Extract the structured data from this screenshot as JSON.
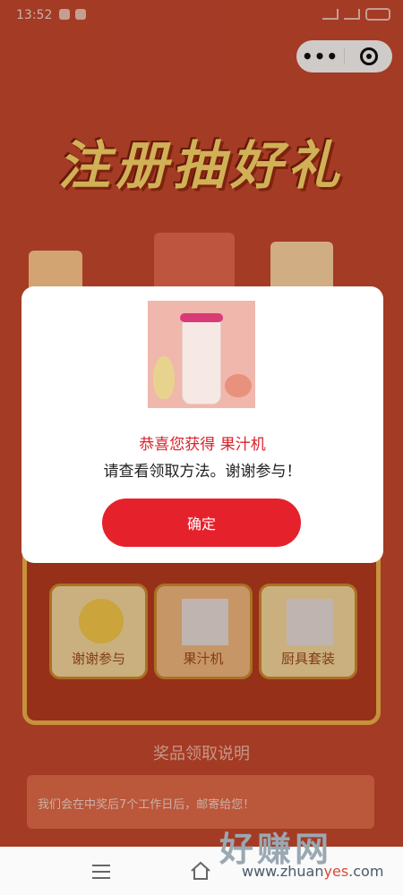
{
  "status_bar": {
    "time": "13:52"
  },
  "capsule": {
    "more_label": "•••"
  },
  "background": {
    "title": "注册抽好礼",
    "cards": [
      {
        "label": "谢谢参与"
      },
      {
        "label": "果汁机"
      },
      {
        "label": "厨具套装"
      }
    ],
    "prize_heading": "奖品领取说明",
    "prize_text": "我们会在中奖后7个工作日后，邮寄给您！"
  },
  "modal": {
    "title": "恭喜您获得 果汁机",
    "subtitle": "请查看领取方法。谢谢参与！",
    "confirm": "确定"
  },
  "watermark": {
    "main": "好赚网",
    "url_left": "www.zhuan",
    "url_mid": "yes",
    "url_right": ".com"
  },
  "colors": {
    "accent": "#e5222c",
    "background": "#c8482e"
  }
}
